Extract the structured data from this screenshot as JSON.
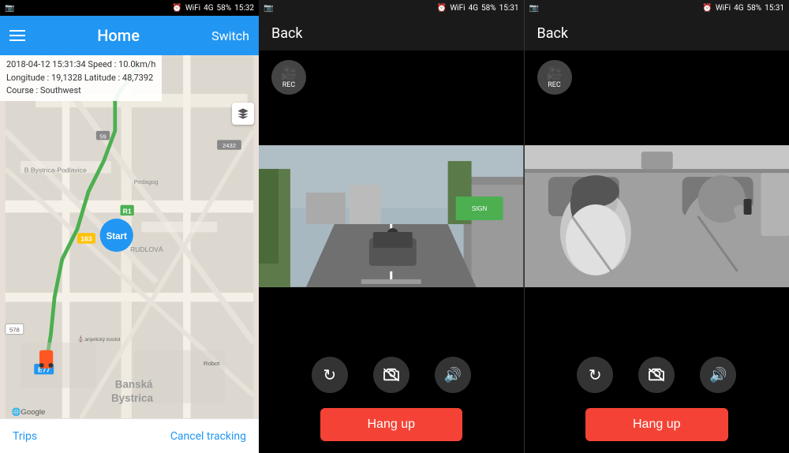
{
  "panel1": {
    "statusBar": {
      "camera": "📷",
      "time": "15:32",
      "battery": "58%",
      "signal": "4G"
    },
    "appBar": {
      "menuIcon": "☰",
      "title": "Home",
      "switchLabel": "Switch"
    },
    "infoBar": {
      "line1": "2018-04-12  15:31:34   Speed : 10.0km/h",
      "line2": "Longitude : 19,1328   Latitude : 48,7392",
      "line3": "Course : Southwest"
    },
    "bottomBar": {
      "tripsLabel": "Trips",
      "cancelLabel": "Cancel tracking"
    }
  },
  "panel2": {
    "statusBar": {
      "time": "15:31"
    },
    "topBar": {
      "backLabel": "Back"
    },
    "recLabel": "REC",
    "controls": {
      "rotate": "↻",
      "camera": "📷",
      "volume": "🔊"
    },
    "hangUpLabel": "Hang up"
  },
  "panel3": {
    "statusBar": {
      "time": "15:31"
    },
    "topBar": {
      "backLabel": "Back"
    },
    "recLabel": "REC",
    "controls": {
      "rotate": "↻",
      "camera": "📷",
      "volume": "🔊"
    },
    "hangUpLabel": "Hang up"
  },
  "colors": {
    "blue": "#2196F3",
    "red": "#f44336",
    "dark": "#1a1a1a",
    "mapBg": "#e8e0d8"
  }
}
